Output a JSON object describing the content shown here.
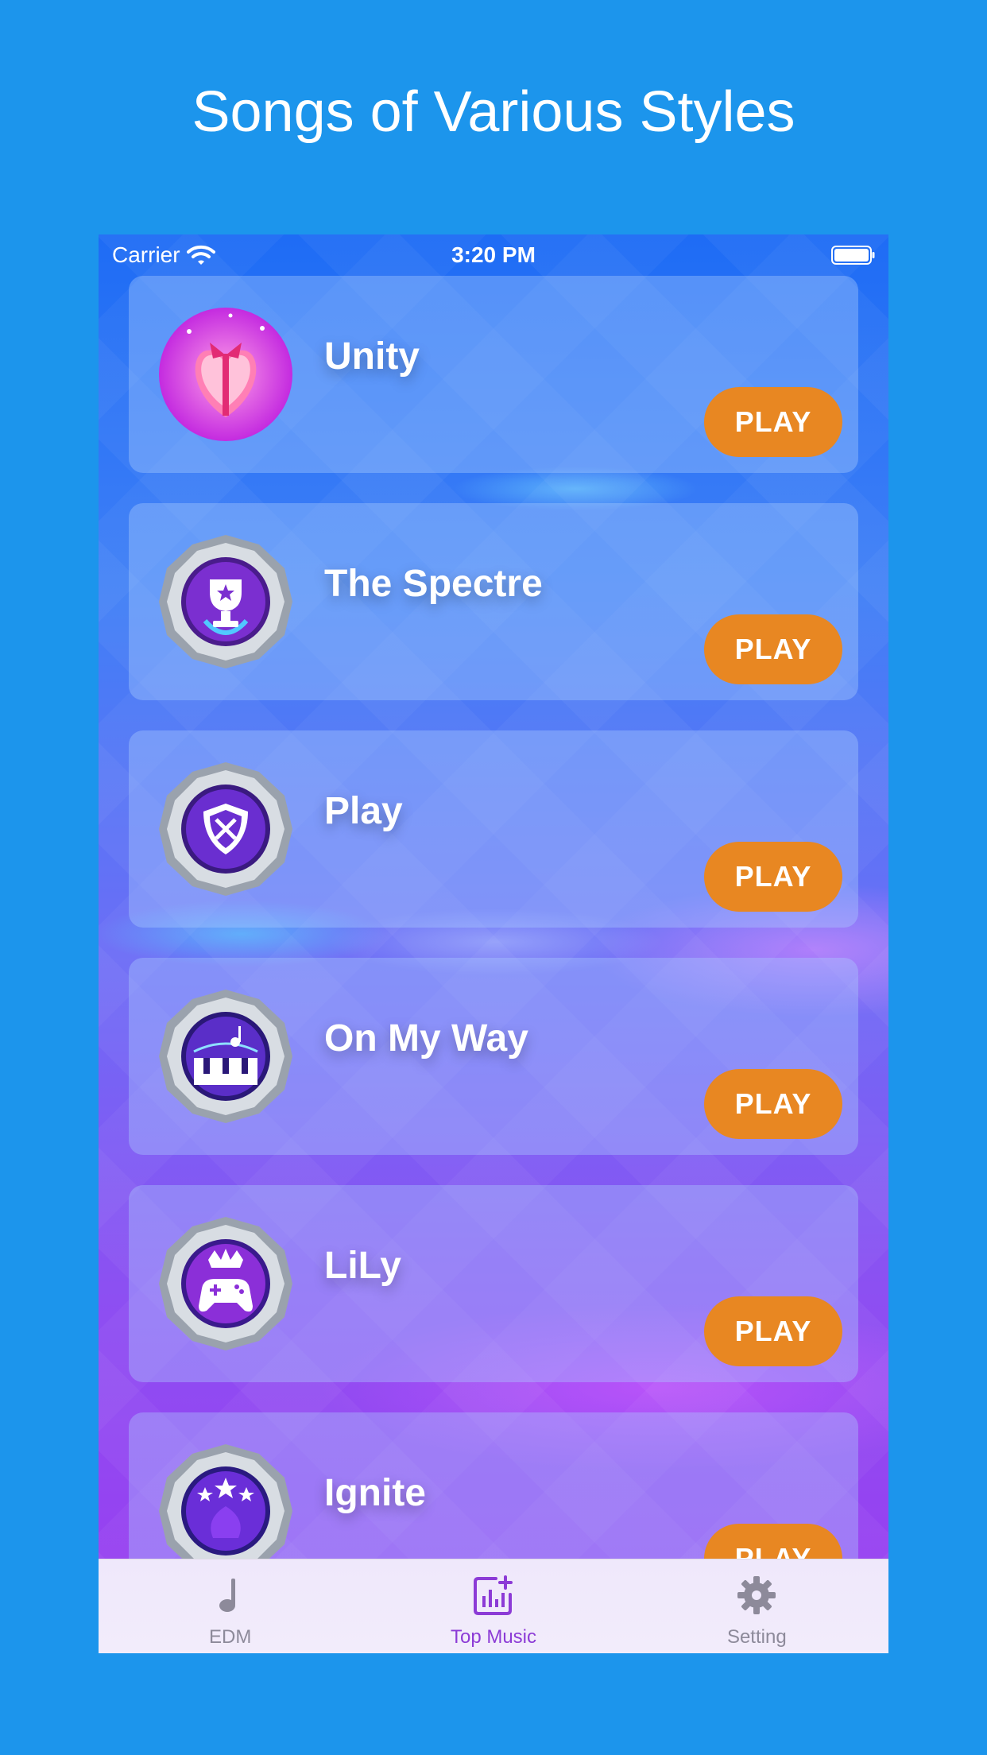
{
  "headline": "Songs of Various Styles",
  "status_bar": {
    "carrier": "Carrier",
    "time": "3:20 PM"
  },
  "songs": [
    {
      "title": "Unity",
      "badge": "heart-gift-icon",
      "play_label": "PLAY"
    },
    {
      "title": "The Spectre",
      "badge": "trophy-badge-icon",
      "play_label": "PLAY"
    },
    {
      "title": "Play",
      "badge": "shield-swords-badge-icon",
      "play_label": "PLAY"
    },
    {
      "title": "On My Way",
      "badge": "piano-badge-icon",
      "play_label": "PLAY"
    },
    {
      "title": "LiLy",
      "badge": "gamepad-badge-icon",
      "play_label": "PLAY"
    },
    {
      "title": "Ignite",
      "badge": "stars-badge-icon",
      "play_label": "PLAY"
    }
  ],
  "tabs": [
    {
      "label": "EDM",
      "icon": "music-note-icon",
      "active": false
    },
    {
      "label": "Top Music",
      "icon": "chart-plus-icon",
      "active": true
    },
    {
      "label": "Setting",
      "icon": "gear-icon",
      "active": false
    }
  ],
  "colors": {
    "background": "#1c95ec",
    "play_button": "#e88722",
    "tab_active": "#8c3bd6",
    "tab_inactive": "#8d8a9a"
  }
}
